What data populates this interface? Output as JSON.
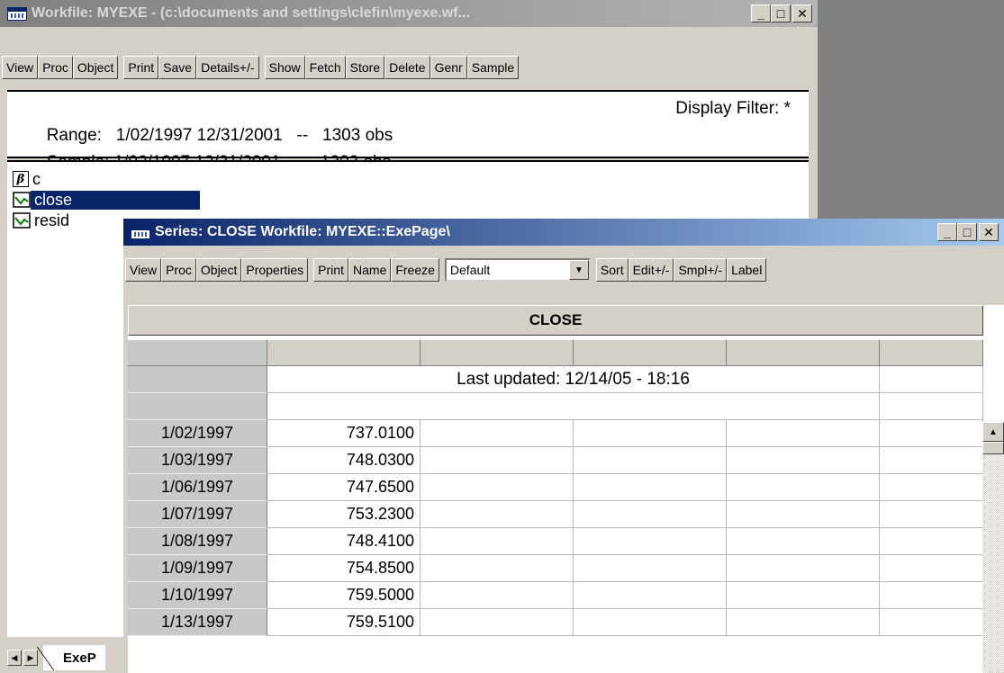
{
  "workfile_window": {
    "title": "Workfile: MYEXE - (c:\\documents and settings\\clefin\\myexe.wf...",
    "controls": {
      "minimize": "_",
      "maximize": "□",
      "close": "✕"
    },
    "toolbar": [
      "View",
      "Proc",
      "Object",
      "Print",
      "Save",
      "Details+/-",
      "Show",
      "Fetch",
      "Store",
      "Delete",
      "Genr",
      "Sample"
    ],
    "range_text": "Range:   1/02/1997 12/31/2001   --   1303 obs",
    "sample_text": "Sample: 1/02/1997 12/31/2001   --   1303 obs",
    "display_filter": "Display Filter: *",
    "objects": [
      {
        "name": "c",
        "icon": "coefficient-icon",
        "selected": false
      },
      {
        "name": "close",
        "icon": "series-icon",
        "selected": true
      },
      {
        "name": "resid",
        "icon": "series-icon",
        "selected": false
      }
    ],
    "page_tab": "ExeP"
  },
  "series_window": {
    "title": "Series: CLOSE   Workfile: MYEXE::ExePage\\",
    "controls": {
      "minimize": "_",
      "maximize": "□",
      "close": "✕"
    },
    "toolbar": {
      "left": [
        "View",
        "Proc",
        "Object",
        "Properties",
        "Print",
        "Name",
        "Freeze"
      ],
      "combo_value": "Default",
      "right": [
        "Sort",
        "Edit+/-",
        "Smpl+/-",
        "Label"
      ]
    },
    "header": "CLOSE",
    "last_updated": "Last updated: 12/14/05 - 18:16",
    "rows": [
      {
        "date": "1/02/1997",
        "value": "737.0100"
      },
      {
        "date": "1/03/1997",
        "value": "748.0300"
      },
      {
        "date": "1/06/1997",
        "value": "747.6500"
      },
      {
        "date": "1/07/1997",
        "value": "753.2300"
      },
      {
        "date": "1/08/1997",
        "value": "748.4100"
      },
      {
        "date": "1/09/1997",
        "value": "754.8500"
      },
      {
        "date": "1/10/1997",
        "value": "759.5000"
      },
      {
        "date": "1/13/1997",
        "value": "759.5100"
      }
    ]
  }
}
